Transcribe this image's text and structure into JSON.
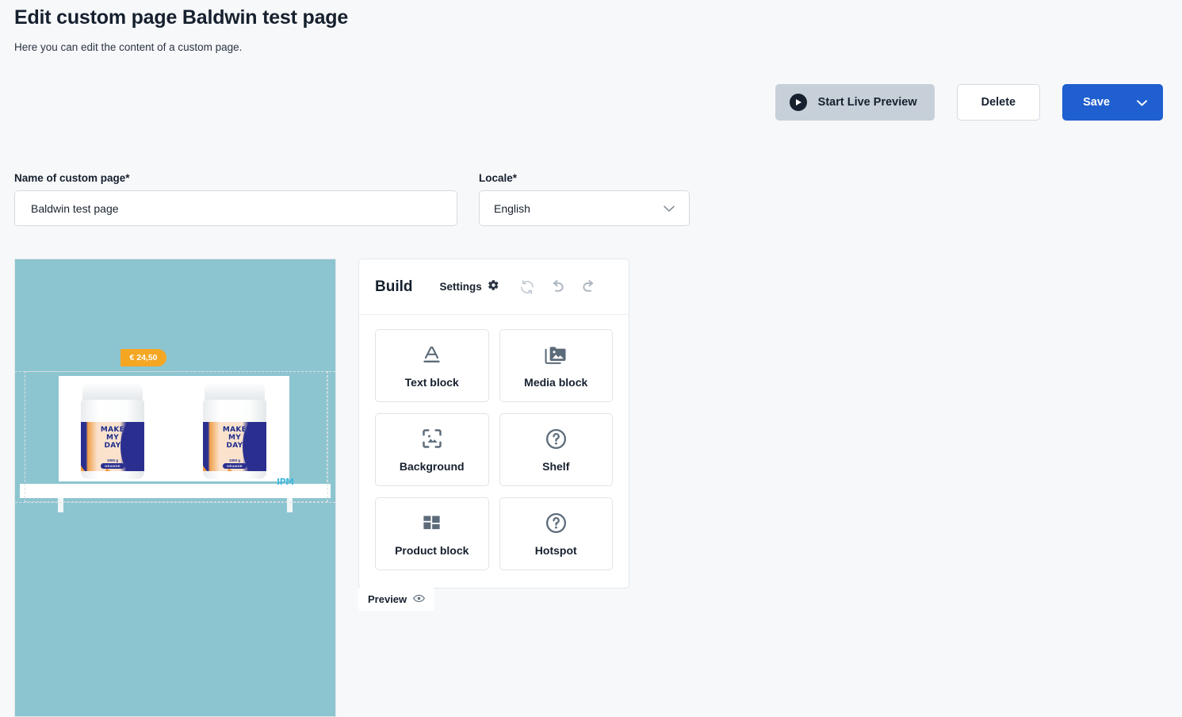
{
  "header": {
    "title": "Edit custom page Baldwin test page",
    "subtitle": "Here you can edit the content of a custom page."
  },
  "actions": {
    "start_live_preview": "Start Live Preview",
    "delete": "Delete",
    "save": "Save",
    "save_chevron": "⌄",
    "play_icon": "play-icon",
    "accent_color": "#1f5fcf",
    "preview_btn_color": "#c7d0d9"
  },
  "form": {
    "name_label": "Name of custom page*",
    "name_value": "Baldwin test page",
    "name_placeholder": "Name of custom page",
    "locale_label": "Locale*",
    "locale_value": "English",
    "locale_chevron": "⌄"
  },
  "canvas": {
    "background_color": "#8cc5d0",
    "price_badge": "€ 24,50",
    "price_badge_color": "#f5a623",
    "watermark": "IPM",
    "watermark_color": "#45b9dd",
    "product": {
      "line1": "MAKE",
      "line2": "MY",
      "line3": "DAY",
      "weight": "1000 g",
      "flavor": "ORANGE"
    }
  },
  "build": {
    "title": "Build",
    "settings_label": "Settings",
    "icons": {
      "settings": "gear-icon",
      "refresh": "refresh-icon",
      "undo": "undo-icon",
      "redo": "redo-icon"
    },
    "blocks": [
      {
        "label": "Text block",
        "icon": "text-underline-icon"
      },
      {
        "label": "Media block",
        "icon": "media-images-icon"
      },
      {
        "label": "Background",
        "icon": "background-image-icon"
      },
      {
        "label": "Shelf",
        "icon": "question-circle-icon"
      },
      {
        "label": "Product block",
        "icon": "grid-blocks-icon"
      },
      {
        "label": "Hotspot",
        "icon": "question-circle-icon"
      }
    ]
  },
  "preview_tab": {
    "label": "Preview",
    "icon": "eye-icon"
  }
}
